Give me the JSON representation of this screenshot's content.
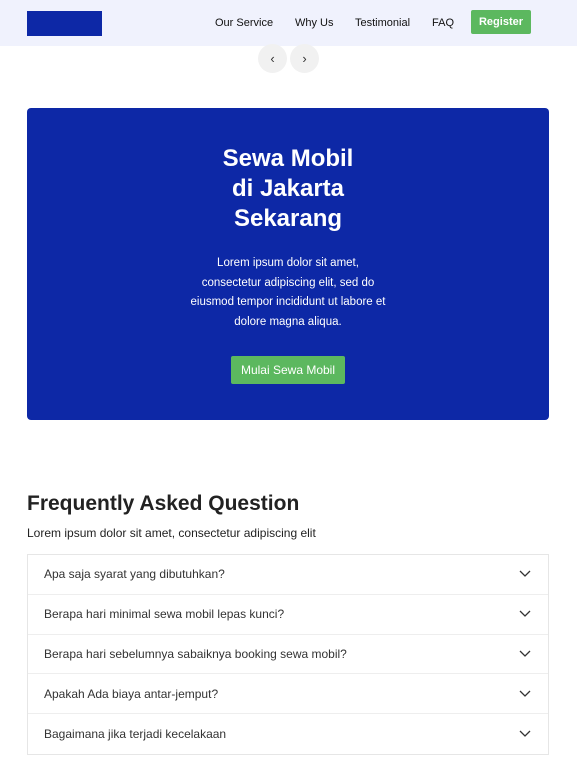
{
  "header": {
    "nav": [
      "Our Service",
      "Why Us",
      "Testimonial",
      "FAQ"
    ],
    "register_label": "Register",
    "brand_color": "#0d28a6",
    "accent_color": "#5cb85f"
  },
  "carousel": {
    "prev_icon": "‹",
    "next_icon": "›"
  },
  "banner": {
    "title_lines": [
      "Sewa Mobil",
      "di Jakarta",
      "Sekarang"
    ],
    "description": "Lorem ipsum dolor sit amet, consectetur adipiscing elit, sed do eiusmod tempor incididunt ut labore et dolore magna aliqua.",
    "cta_label": "Mulai Sewa Mobil"
  },
  "faq": {
    "title": "Frequently Asked Question",
    "subtitle": "Lorem ipsum dolor sit amet, consectetur adipiscing elit",
    "items": [
      "Apa saja syarat yang dibutuhkan?",
      "Berapa hari minimal sewa mobil lepas kunci?",
      "Berapa hari sebelumnya sabaiknya booking sewa mobil?",
      "Apakah Ada biaya antar-jemput?",
      "Bagaimana jika terjadi kecelakaan"
    ],
    "item_icon": "chevron-down-icon"
  }
}
